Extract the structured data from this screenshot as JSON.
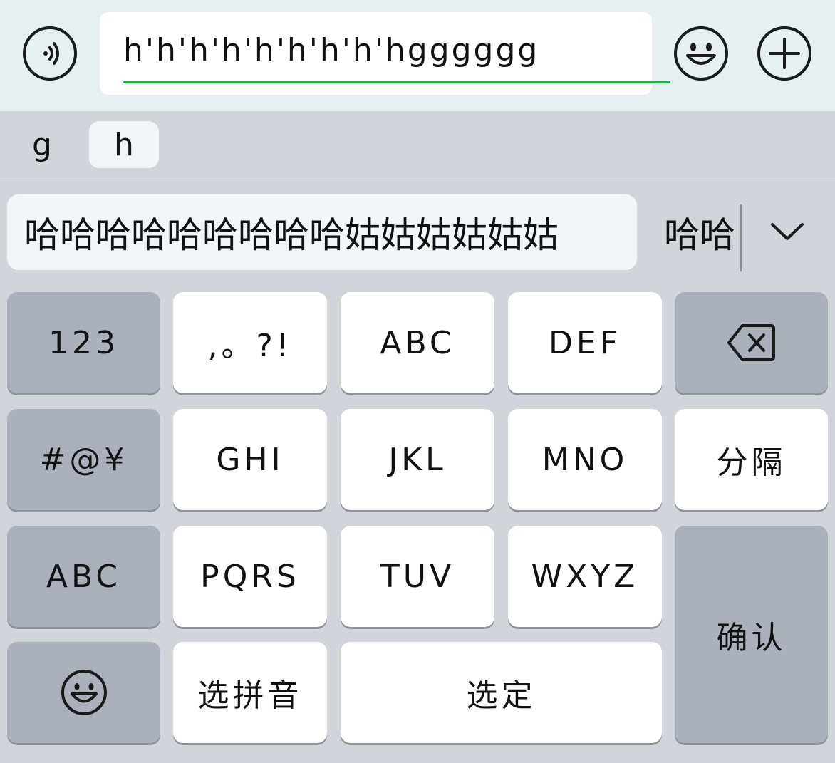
{
  "input_bar": {
    "voice_icon": "voice-wave-icon",
    "text": "h'h'h'h'h'h'h'h'hgggggg",
    "emoji_icon": "smiley-icon",
    "add_icon": "plus-circle-icon",
    "underline_color": "#22b04c"
  },
  "pinyin_options": [
    "g",
    "h"
  ],
  "candidates": {
    "primary": "哈哈哈哈哈哈哈哈哈姑姑姑姑姑姑",
    "secondary": "哈哈",
    "expand_icon": "chevron-down-icon"
  },
  "keys": {
    "num": "123",
    "punct": ",。?!",
    "abc_key": "ABC",
    "def": "DEF",
    "backspace_icon": "backspace-icon",
    "symbols": "#@¥",
    "ghi": "GHI",
    "jkl": "JKL",
    "mno": "MNO",
    "separator": "分隔",
    "abc_mode": "ABC",
    "pqrs": "PQRS",
    "tuv": "TUV",
    "wxyz": "WXYZ",
    "confirm": "确认",
    "emoji_icon": "smiley-icon",
    "select_pinyin": "选拼音",
    "select": "选定"
  }
}
